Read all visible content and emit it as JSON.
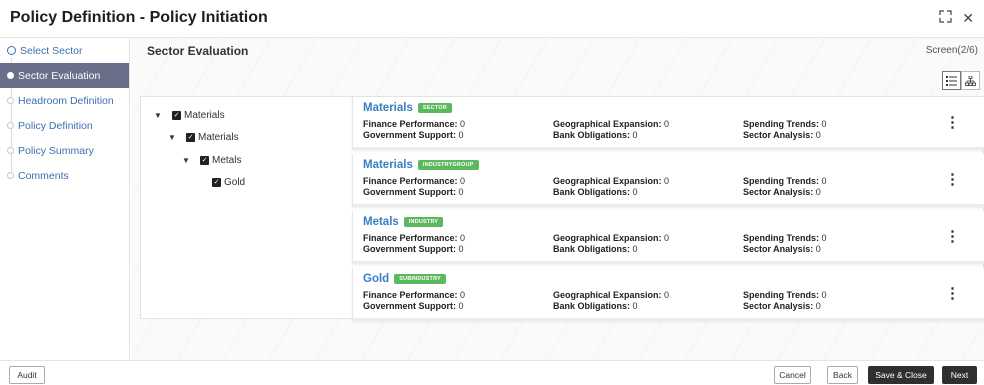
{
  "header": {
    "title": "Policy Definition - Policy Initiation"
  },
  "sidebar": {
    "steps": [
      {
        "label": "Select Sector"
      },
      {
        "label": "Sector Evaluation"
      },
      {
        "label": "Headroom Definition"
      },
      {
        "label": "Policy Definition"
      },
      {
        "label": "Policy Summary"
      },
      {
        "label": "Comments"
      }
    ]
  },
  "main": {
    "section_title": "Sector Evaluation",
    "screen_count": "Screen(2/6)"
  },
  "tree": {
    "nodes": [
      {
        "label": "Materials"
      },
      {
        "label": "Materials"
      },
      {
        "label": "Metals"
      },
      {
        "label": "Gold"
      }
    ]
  },
  "cards": [
    {
      "name": "Materials",
      "badge": "SECTOR",
      "finance_label": "Finance Performance:",
      "finance": "0",
      "gov_label": "Government Support:",
      "gov": "0",
      "geo_label": "Geographical Expansion:",
      "geo": "0",
      "bank_label": "Bank Obligations:",
      "bank": "0",
      "spend_label": "Spending Trends:",
      "spend": "0",
      "sector_label": "Sector Analysis:",
      "sector": "0"
    },
    {
      "name": "Materials",
      "badge": "INDUSTRYGROUP",
      "finance_label": "Finance Performance:",
      "finance": "0",
      "gov_label": "Government Support:",
      "gov": "0",
      "geo_label": "Geographical Expansion:",
      "geo": "0",
      "bank_label": "Bank Obligations:",
      "bank": "0",
      "spend_label": "Spending Trends:",
      "spend": "0",
      "sector_label": "Sector Analysis:",
      "sector": "0"
    },
    {
      "name": "Metals",
      "badge": "INDUSTRY",
      "finance_label": "Finance Performance:",
      "finance": "0",
      "gov_label": "Government Support:",
      "gov": "0",
      "geo_label": "Geographical Expansion:",
      "geo": "0",
      "bank_label": "Bank Obligations:",
      "bank": "0",
      "spend_label": "Spending Trends:",
      "spend": "0",
      "sector_label": "Sector Analysis:",
      "sector": "0"
    },
    {
      "name": "Gold",
      "badge": "SUBINDUSTRY",
      "finance_label": "Finance Performance:",
      "finance": "0",
      "gov_label": "Government Support:",
      "gov": "0",
      "geo_label": "Geographical Expansion:",
      "geo": "0",
      "bank_label": "Bank Obligations:",
      "bank": "0",
      "spend_label": "Spending Trends:",
      "spend": "0",
      "sector_label": "Sector Analysis:",
      "sector": "0"
    }
  ],
  "footer": {
    "audit": "Audit",
    "cancel": "Cancel",
    "back": "Back",
    "save_close": "Save & Close",
    "next": "Next"
  },
  "icons": {
    "expand": "expand-icon",
    "close": "close-icon",
    "list_view": "list-view-icon",
    "tree_view": "hierarchy-view-icon",
    "kebab": "kebab-menu-icon"
  },
  "colors": {
    "active_step_bg": "#6a6e88",
    "link_blue": "#3a7fc1",
    "badge_green": "#5cb85c",
    "primary_button": "#2f2f2f"
  }
}
